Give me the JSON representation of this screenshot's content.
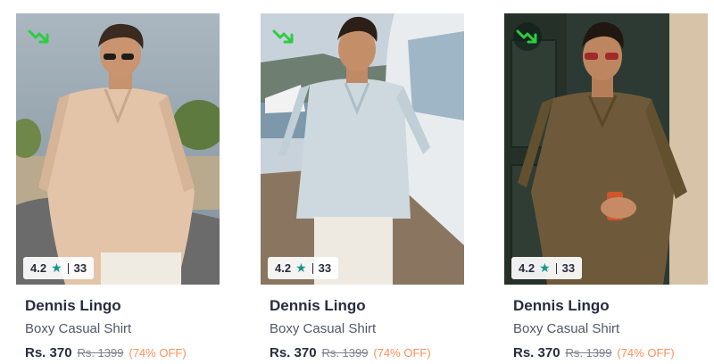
{
  "products": [
    {
      "brand": "Dennis Lingo",
      "name": "Boxy Casual Shirt",
      "price": "Rs. 370",
      "mrp": "Rs. 1399",
      "discount": "(74% OFF)",
      "rating": "4.2",
      "rating_count": "33",
      "shirt_color": "#e3c4a9",
      "trend_icon": "trending-down-icon"
    },
    {
      "brand": "Dennis Lingo",
      "name": "Boxy Casual Shirt",
      "price": "Rs. 370",
      "mrp": "Rs. 1399",
      "discount": "(74% OFF)",
      "rating": "4.2",
      "rating_count": "33",
      "shirt_color": "#cdd9df",
      "trend_icon": "trending-down-icon"
    },
    {
      "brand": "Dennis Lingo",
      "name": "Boxy Casual Shirt",
      "price": "Rs. 370",
      "mrp": "Rs. 1399",
      "discount": "(74% OFF)",
      "rating": "4.2",
      "rating_count": "33",
      "shirt_color": "#6e5a3a",
      "trend_icon": "trending-down-icon"
    }
  ],
  "colors": {
    "trend_green": "#2ecc40",
    "rating_star": "#14958f",
    "discount": "#ff905a"
  }
}
